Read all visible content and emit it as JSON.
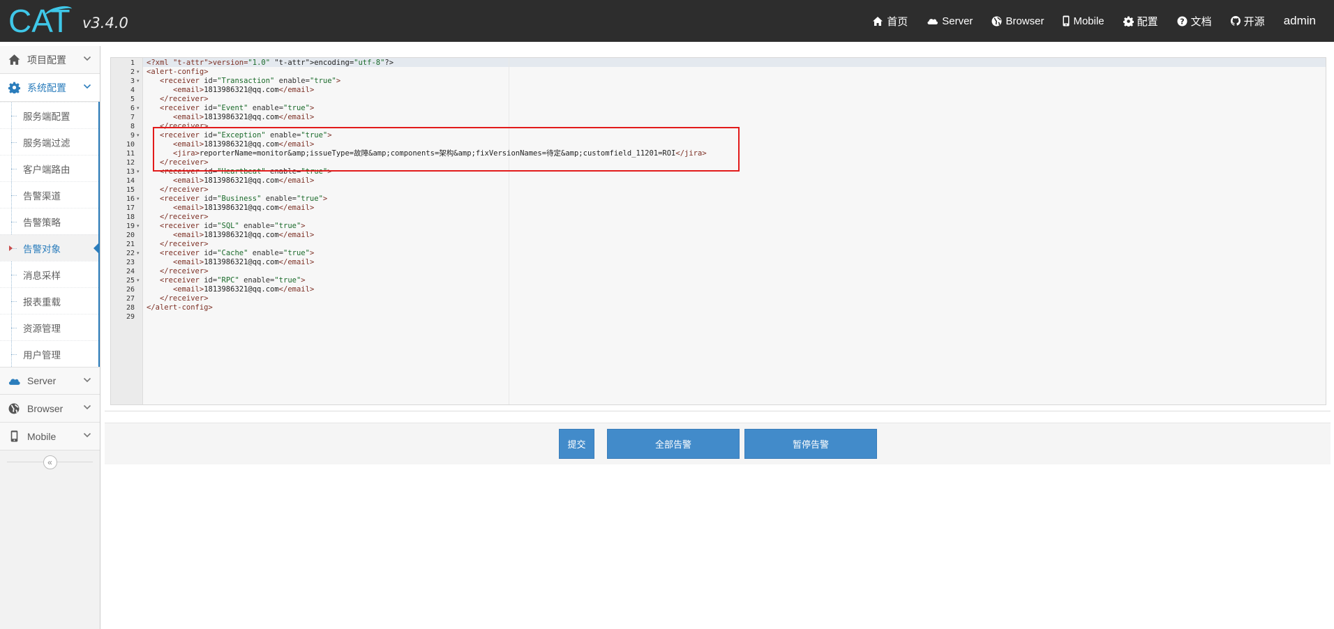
{
  "brand": {
    "logo_text": "CAT",
    "version": "v3.4.0"
  },
  "nav": {
    "items": [
      {
        "label": "首页",
        "icon": "home-icon"
      },
      {
        "label": "Server",
        "icon": "cloud-icon"
      },
      {
        "label": "Browser",
        "icon": "globe-icon"
      },
      {
        "label": "Mobile",
        "icon": "mobile-icon"
      },
      {
        "label": "配置",
        "icon": "gear-icon"
      },
      {
        "label": "文档",
        "icon": "question-icon"
      },
      {
        "label": "开源",
        "icon": "github-icon"
      }
    ],
    "user": "admin"
  },
  "sidebar": {
    "project_config": "项目配置",
    "system_config": "系统配置",
    "system_items": [
      "服务端配置",
      "服务端过滤",
      "客户端路由",
      "告警渠道",
      "告警策略",
      "告警对象",
      "消息采样",
      "报表重载",
      "资源管理",
      "用户管理"
    ],
    "active_item": "告警对象",
    "server": "Server",
    "browser": "Browser",
    "mobile": "Mobile",
    "collapse_glyph": "«"
  },
  "editor": {
    "line_numbers": [
      "1",
      "2",
      "3",
      "4",
      "5",
      "6",
      "7",
      "8",
      "9",
      "10",
      "11",
      "12",
      "13",
      "14",
      "15",
      "16",
      "17",
      "18",
      "19",
      "20",
      "21",
      "22",
      "23",
      "24",
      "25",
      "26",
      "27",
      "28",
      "29"
    ],
    "fold_lines": [
      "2",
      "3",
      "6",
      "9",
      "13",
      "16",
      "19",
      "22",
      "25"
    ],
    "lines": [
      "<?xml version=\"1.0\" encoding=\"utf-8\"?>",
      "<alert-config>",
      "   <receiver id=\"Transaction\" enable=\"true\">",
      "      <email>1813986321@qq.com</email>",
      "   </receiver>",
      "   <receiver id=\"Event\" enable=\"true\">",
      "      <email>1813986321@qq.com</email>",
      "   </receiver>",
      "   <receiver id=\"Exception\" enable=\"true\">",
      "      <email>1813986321@qq.com</email>",
      "      <jira>reporterName=monitor&amp;issueType=故障&amp;components=架构&amp;fixVersionNames=待定&amp;customfield_11201=ROI</jira>",
      "   </receiver>",
      "   <receiver id=\"Heartbeat\" enable=\"true\">",
      "      <email>1813986321@qq.com</email>",
      "   </receiver>",
      "   <receiver id=\"Business\" enable=\"true\">",
      "      <email>1813986321@qq.com</email>",
      "   </receiver>",
      "   <receiver id=\"SQL\" enable=\"true\">",
      "      <email>1813986321@qq.com</email>",
      "   </receiver>",
      "   <receiver id=\"Cache\" enable=\"true\">",
      "      <email>1813986321@qq.com</email>",
      "   </receiver>",
      "   <receiver id=\"RPC\" enable=\"true\">",
      "      <email>1813986321@qq.com</email>",
      "   </receiver>",
      "</alert-config>",
      ""
    ]
  },
  "actions": {
    "submit": "提交",
    "all_alert": "全部告警",
    "pause_alert": "暂停告警"
  },
  "colors": {
    "navbar_bg": "#2d2d2d",
    "logo": "#3fc7e8",
    "primary": "#428bca",
    "active_menu": "#2b7dbc",
    "highlight_box": "#e21b1b"
  }
}
